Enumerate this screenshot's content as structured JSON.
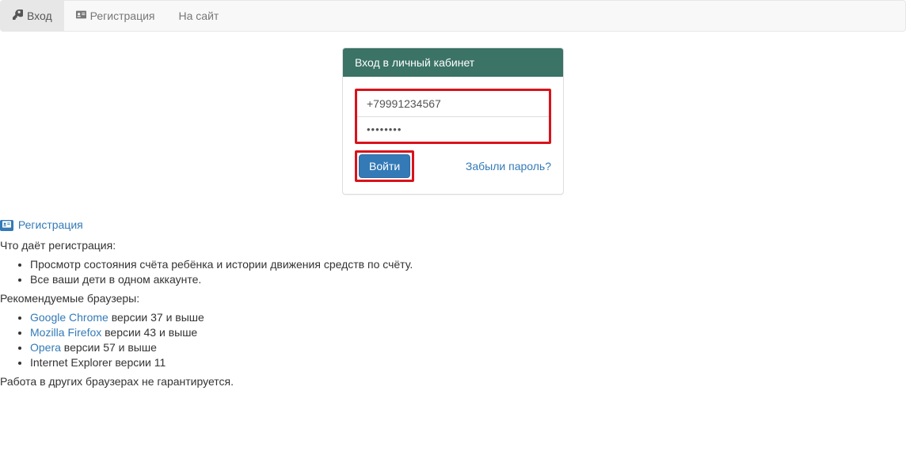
{
  "navbar": {
    "login": "Вход",
    "register": "Регистрация",
    "site": "На сайт"
  },
  "panel": {
    "title": "Вход в личный кабинет",
    "phone_value": "+79991234567",
    "password_display": "••••••••",
    "submit": "Войти",
    "forgot": "Забыли пароль?"
  },
  "reg_link": "Регистрация",
  "info": {
    "benefits_title": "Что даёт регистрация:",
    "benefits": [
      "Просмотр состояния счёта ребёнка и истории движения средств по счёту.",
      "Все ваши дети в одном аккаунте."
    ],
    "browsers_title": "Рекомендуемые браузеры:",
    "chrome_name": "Google Chrome",
    "chrome_suffix": " версии 37 и выше",
    "firefox_name": "Mozilla Firefox",
    "firefox_suffix": " версии 43 и выше",
    "opera_name": "Opera",
    "opera_suffix": " версии 57 и выше",
    "ie_text": "Internet Explorer версии 11",
    "disclaimer": "Работа в других браузерах не гарантируется."
  }
}
